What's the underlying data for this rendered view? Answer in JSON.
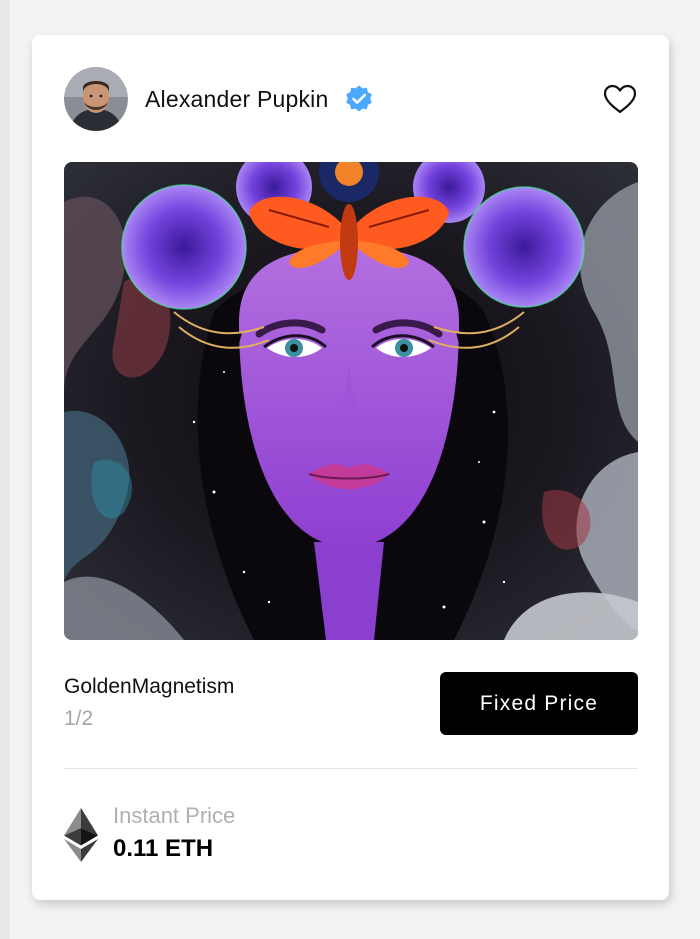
{
  "card": {
    "author": {
      "name": "Alexander Pupkin",
      "verified": true,
      "avatar_icon": "user-avatar"
    },
    "favorite_icon": "heart-outline-icon",
    "artwork": {
      "subject": "purple-woman-portrait-with-flowers-and-moth"
    },
    "nft": {
      "title": "GoldenMagnetism",
      "edition": "1/2"
    },
    "sale_type_button": "Fixed Price",
    "price": {
      "label": "Instant Price",
      "value": "0.11 ETH",
      "currency_icon": "ethereum-icon"
    }
  },
  "colors": {
    "accent_verified": "#4aa8ff",
    "button_bg": "#000000",
    "muted_text": "#a7a7a7"
  }
}
